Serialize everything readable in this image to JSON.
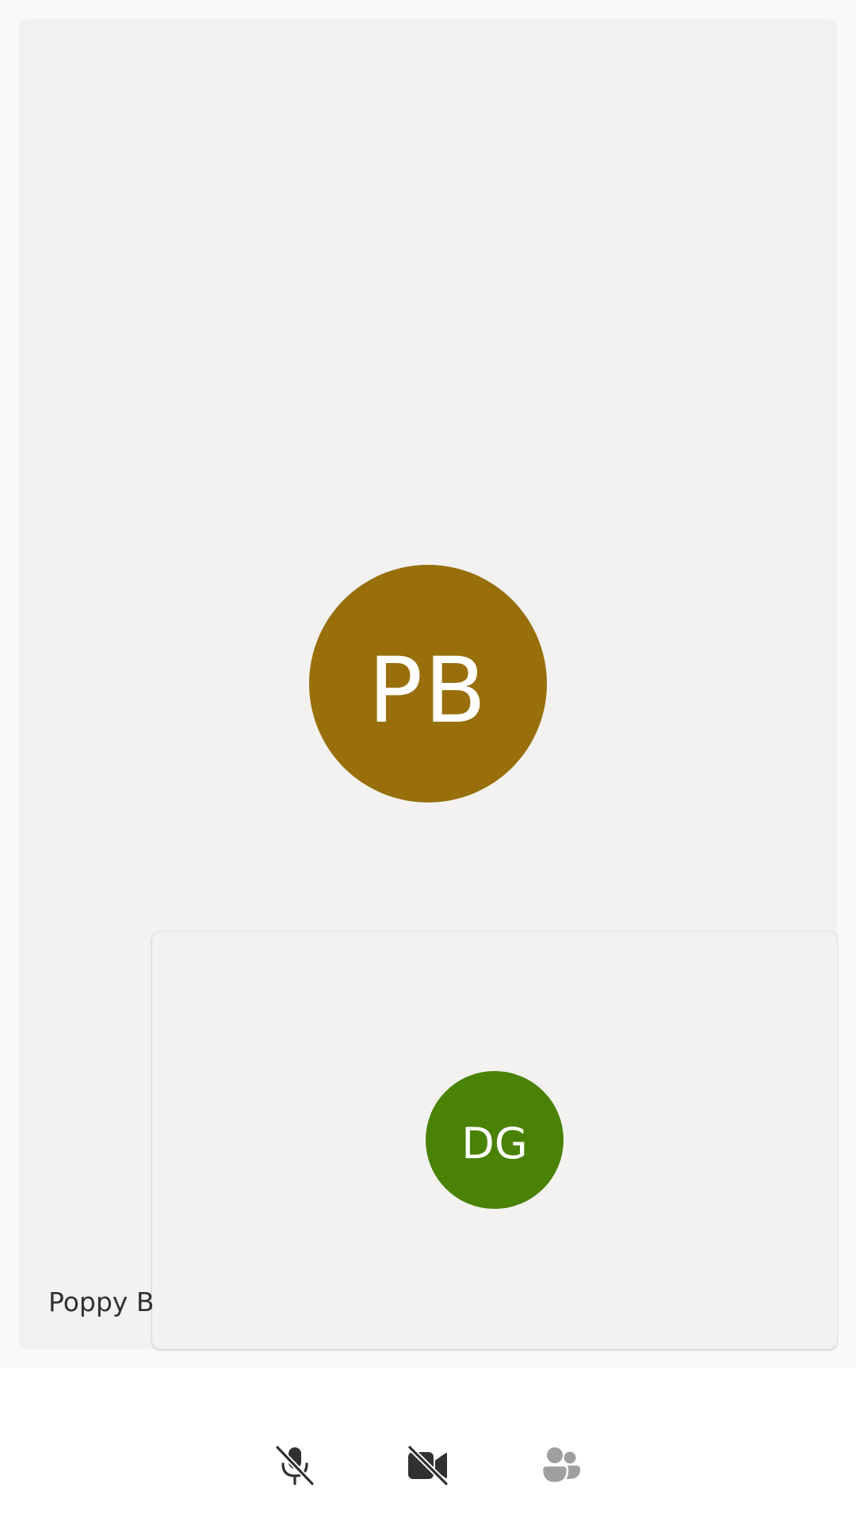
{
  "main_participant": {
    "initials": "PB",
    "name_visible": "Poppy B",
    "avatar_color": "#986f0b"
  },
  "self_preview": {
    "initials": "DG",
    "avatar_color": "#498205"
  },
  "controls": {
    "mic": {
      "icon": "mic-off-icon",
      "state": "muted",
      "color": "#323130"
    },
    "camera": {
      "icon": "video-off-icon",
      "state": "off",
      "color": "#323130"
    },
    "people": {
      "icon": "people-icon",
      "state": "disabled",
      "color": "#a19f9d"
    }
  },
  "colors": {
    "stage_background": "#faf9f8",
    "tile_background": "#f3f2f1",
    "controls_background": "#ffffff"
  }
}
